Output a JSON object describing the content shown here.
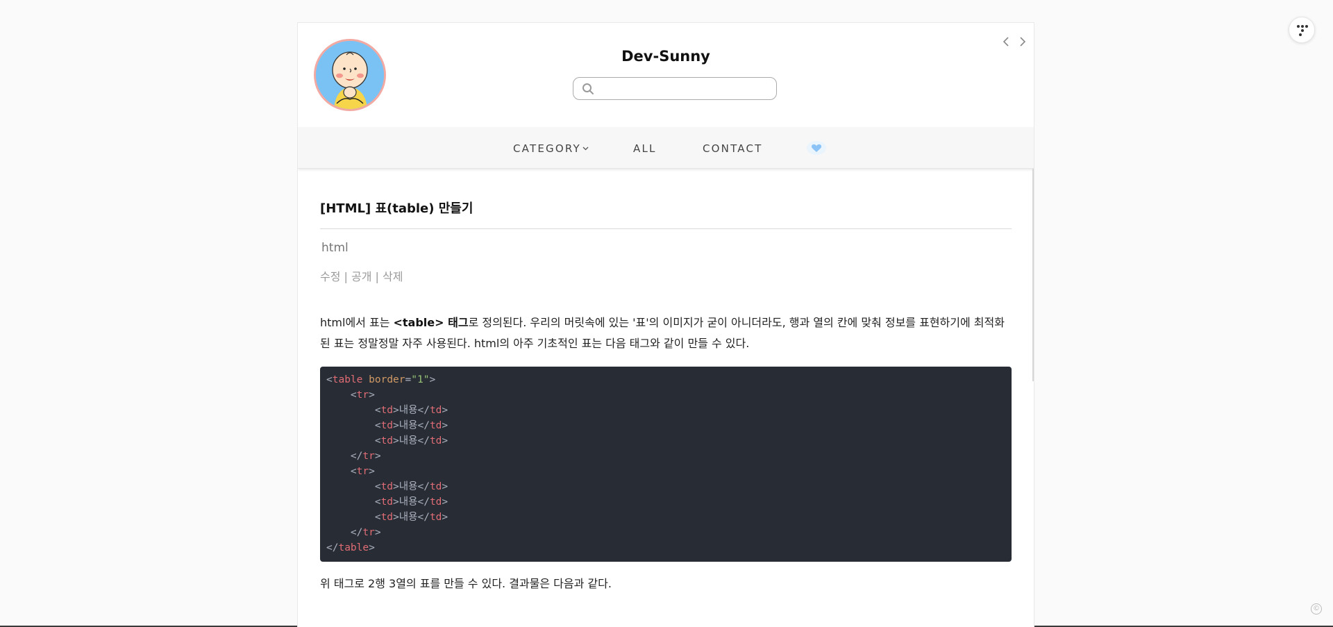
{
  "blog": {
    "title": "Dev-Sunny",
    "search_placeholder": ""
  },
  "nav": {
    "category_label": "CATEGORY",
    "all_label": "ALL",
    "contact_label": "CONTACT"
  },
  "post": {
    "title": "[HTML] 표(table) 만들기",
    "category": "html",
    "admin": {
      "edit": "수정",
      "public": "공개",
      "delete": "삭제",
      "separator": " | "
    },
    "intro_before": "html에서 표는 ",
    "intro_bold": "<table> 태그",
    "intro_after": "로 정의된다. 우리의 머릿속에 있는 '표'의 이미지가 굳이 아니더라도, 행과 열의 칸에 맞춰 정보를 표현하기에 최적화된 표는 정말정말 자주 사용된다. html의 아주 기초적인 표는 다음 태그와 같이 만들 수 있다.",
    "cell_text": "내용",
    "after_code": "위 태그로 2행 3열의 표를 만들 수 있다. 결과물은 다음과 같다."
  },
  "code": {
    "table_tag": "table",
    "border_attr": "border",
    "border_value": "\"1\"",
    "tr_tag": "tr",
    "td_tag": "td"
  },
  "icons": {
    "heart": "heart-icon",
    "search": "search-icon",
    "menu": "menu-dots-icon",
    "copyright": "copyright-icon"
  },
  "colors": {
    "heart": "#8cc3f7",
    "code_bg": "#282c34",
    "code_tag": "#e06c75",
    "code_attr": "#d19a66",
    "code_string": "#98c379",
    "avatar_ring": "#f2a9a2"
  }
}
